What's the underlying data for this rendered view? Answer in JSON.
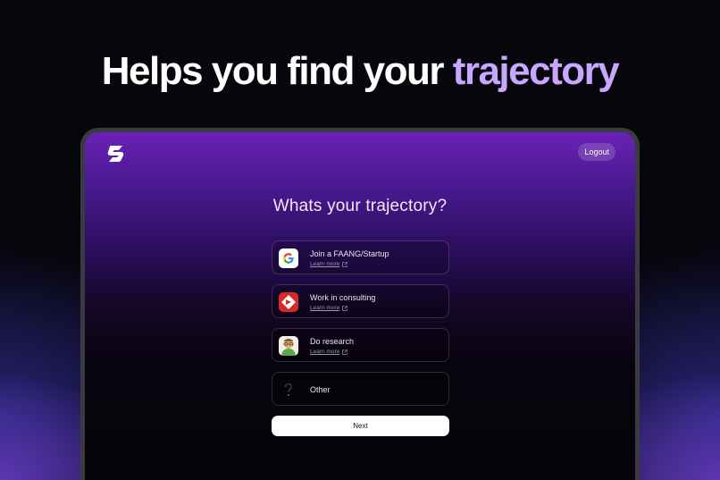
{
  "headline": {
    "prefix": "Helps you find your",
    "accent": "trajectory",
    "accent_color": "#c9a6ff"
  },
  "app": {
    "logo_icon": "s-logo-icon",
    "logout_label": "Logout",
    "question": "Whats your trajectory?",
    "options": [
      {
        "icon": "google-icon",
        "title": "Join a FAANG/Startup",
        "link": "Learn more"
      },
      {
        "icon": "consulting-icon",
        "title": "Work in consulting",
        "link": "Learn more"
      },
      {
        "icon": "research-avatar-icon",
        "title": "Do research",
        "link": "Learn more"
      },
      {
        "icon": "question-mark-icon",
        "title": "Other"
      }
    ],
    "next_label": "Next"
  }
}
